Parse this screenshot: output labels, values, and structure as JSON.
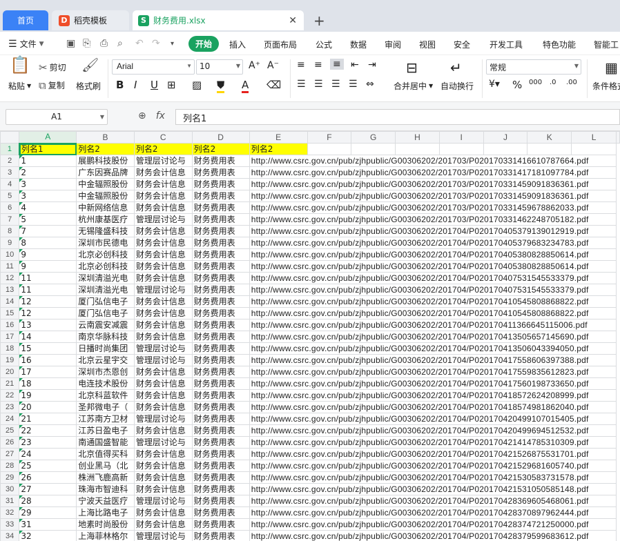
{
  "tabs": {
    "home": "首页",
    "template": "稻壳模板",
    "document": "财务费用.xlsx"
  },
  "menu": {
    "file": "文件",
    "items": [
      "开始",
      "插入",
      "页面布局",
      "公式",
      "数据",
      "审阅",
      "视图",
      "安全",
      "开发工具",
      "特色功能",
      "智能工"
    ]
  },
  "ribbon": {
    "paste": "粘贴",
    "cut": "剪切",
    "copy": "复制",
    "format_painter": "格式刷",
    "font_name": "Arial",
    "font_size": "10",
    "merge_center": "合并居中",
    "wrap_text": "自动换行",
    "number_format": "常规",
    "conditional_format": "条件格式"
  },
  "formula_bar": {
    "cell_ref": "A1",
    "fx": "fx",
    "content": "列名1"
  },
  "sheet": {
    "columns": [
      "A",
      "B",
      "C",
      "D",
      "E",
      "F",
      "G",
      "H",
      "I",
      "J",
      "K",
      "L"
    ],
    "header_row": [
      "列名1",
      "列名2",
      "列名2",
      "列名2",
      "列名2"
    ],
    "rows": [
      [
        "2",
        "1",
        "展鹏科技股份",
        "管理层讨论与",
        "财务费用表",
        "http://www.csrc.gov.cn/pub/zjhpublic/G00306202/201703/P020170331416610787664.pdf"
      ],
      [
        "3",
        "2",
        "广东因赛品牌",
        "财务会计信息",
        "财务费用表",
        "http://www.csrc.gov.cn/pub/zjhpublic/G00306202/201703/P020170331417181097784.pdf"
      ],
      [
        "4",
        "3",
        "中金辐照股份",
        "财务会计信息",
        "财务费用表",
        "http://www.csrc.gov.cn/pub/zjhpublic/G00306202/201703/P020170331459091836361.pdf"
      ],
      [
        "5",
        "3",
        "中金辐照股份",
        "财务会计信息",
        "财务费用表",
        "http://www.csrc.gov.cn/pub/zjhpublic/G00306202/201703/P020170331459091836361.pdf"
      ],
      [
        "6",
        "4",
        "中新网络信息",
        "财务会计信息",
        "财务费用表",
        "http://www.csrc.gov.cn/pub/zjhpublic/G00306202/201703/P020170331459678862033.pdf"
      ],
      [
        "7",
        "5",
        "杭州康基医疗",
        "管理层讨论与",
        "财务费用表",
        "http://www.csrc.gov.cn/pub/zjhpublic/G00306202/201703/P020170331462248705182.pdf"
      ],
      [
        "8",
        "7",
        "无锡隆盛科技",
        "财务会计信息",
        "财务费用表",
        "http://www.csrc.gov.cn/pub/zjhpublic/G00306202/201704/P020170405379139012919.pdf"
      ],
      [
        "9",
        "8",
        "深圳市民德电",
        "财务会计信息",
        "财务费用表",
        "http://www.csrc.gov.cn/pub/zjhpublic/G00306202/201704/P020170405379683234783.pdf"
      ],
      [
        "10",
        "9",
        "北京必创科技",
        "财务会计信息",
        "财务费用表",
        "http://www.csrc.gov.cn/pub/zjhpublic/G00306202/201704/P020170405380828850614.pdf"
      ],
      [
        "11",
        "9",
        "北京必创科技",
        "财务会计信息",
        "财务费用表",
        "http://www.csrc.gov.cn/pub/zjhpublic/G00306202/201704/P020170405380828850614.pdf"
      ],
      [
        "12",
        "11",
        "深圳清溢光电",
        "财务会计信息",
        "财务费用表",
        "http://www.csrc.gov.cn/pub/zjhpublic/G00306202/201704/P020170407531545533379.pdf"
      ],
      [
        "13",
        "11",
        "深圳清溢光电",
        "管理层讨论与",
        "财务费用表",
        "http://www.csrc.gov.cn/pub/zjhpublic/G00306202/201704/P020170407531545533379.pdf"
      ],
      [
        "14",
        "12",
        "厦门弘信电子",
        "财务会计信息",
        "财务费用表",
        "http://www.csrc.gov.cn/pub/zjhpublic/G00306202/201704/P020170410545808868822.pdf"
      ],
      [
        "15",
        "12",
        "厦门弘信电子",
        "财务会计信息",
        "财务费用表",
        "http://www.csrc.gov.cn/pub/zjhpublic/G00306202/201704/P020170410545808868822.pdf"
      ],
      [
        "16",
        "13",
        "云南震安减震",
        "财务会计信息",
        "财务费用表",
        "http://www.csrc.gov.cn/pub/zjhpublic/G00306202/201704/P020170411366645115006.pdf"
      ],
      [
        "17",
        "14",
        "南京华脉科技",
        "财务会计信息",
        "财务费用表",
        "http://www.csrc.gov.cn/pub/zjhpublic/G00306202/201704/P020170413505657145690.pdf"
      ],
      [
        "18",
        "15",
        "日播时尚集团",
        "管理层讨论与",
        "财务费用表",
        "http://www.csrc.gov.cn/pub/zjhpublic/G00306202/201704/P020170413506043394050.pdf"
      ],
      [
        "19",
        "16",
        "北京云星宇交",
        "管理层讨论与",
        "财务费用表",
        "http://www.csrc.gov.cn/pub/zjhpublic/G00306202/201704/P020170417558606397388.pdf"
      ],
      [
        "20",
        "17",
        "深圳市杰恩创",
        "财务会计信息",
        "财务费用表",
        "http://www.csrc.gov.cn/pub/zjhpublic/G00306202/201704/P020170417559835612823.pdf"
      ],
      [
        "21",
        "18",
        "电连技术股份",
        "财务会计信息",
        "财务费用表",
        "http://www.csrc.gov.cn/pub/zjhpublic/G00306202/201704/P020170417560198733650.pdf"
      ],
      [
        "22",
        "19",
        "北京科蓝软件",
        "财务会计信息",
        "财务费用表",
        "http://www.csrc.gov.cn/pub/zjhpublic/G00306202/201704/P020170418572624208999.pdf"
      ],
      [
        "23",
        "20",
        "圣邦微电子（",
        "财务会计信息",
        "财务费用表",
        "http://www.csrc.gov.cn/pub/zjhpublic/G00306202/201704/P020170418574981862040.pdf"
      ],
      [
        "24",
        "21",
        "江苏南方卫材",
        "管理层讨论与",
        "财务费用表",
        "http://www.csrc.gov.cn/pub/zjhpublic/G00306202/201704/P020170420499107015405.pdf"
      ],
      [
        "25",
        "22",
        "江苏日盈电子",
        "财务会计信息",
        "财务费用表",
        "http://www.csrc.gov.cn/pub/zjhpublic/G00306202/201704/P020170420499694512532.pdf"
      ],
      [
        "26",
        "23",
        "南通国盛智能",
        "管理层讨论与",
        "财务费用表",
        "http://www.csrc.gov.cn/pub/zjhpublic/G00306202/201704/P020170421414785310309.pdf"
      ],
      [
        "27",
        "24",
        "北京值得买科",
        "财务会计信息",
        "财务费用表",
        "http://www.csrc.gov.cn/pub/zjhpublic/G00306202/201704/P020170421526875531701.pdf"
      ],
      [
        "28",
        "25",
        "创业黑马（北",
        "财务会计信息",
        "财务费用表",
        "http://www.csrc.gov.cn/pub/zjhpublic/G00306202/201704/P020170421529681605740.pdf"
      ],
      [
        "29",
        "26",
        "株洲飞鹿高新",
        "财务会计信息",
        "财务费用表",
        "http://www.csrc.gov.cn/pub/zjhpublic/G00306202/201704/P020170421530583731578.pdf"
      ],
      [
        "30",
        "27",
        "珠海市智迪科",
        "财务会计信息",
        "财务费用表",
        "http://www.csrc.gov.cn/pub/zjhpublic/G00306202/201704/P020170421531050585148.pdf"
      ],
      [
        "31",
        "28",
        "宁波天益医疗",
        "管理层讨论与",
        "财务费用表",
        "http://www.csrc.gov.cn/pub/zjhpublic/G00306202/201704/P020170428369605468061.pdf"
      ],
      [
        "32",
        "29",
        "上海比路电子",
        "财务会计信息",
        "财务费用表",
        "http://www.csrc.gov.cn/pub/zjhpublic/G00306202/201704/P020170428370897962444.pdf"
      ],
      [
        "33",
        "31",
        "地素时尚股份",
        "财务会计信息",
        "财务费用表",
        "http://www.csrc.gov.cn/pub/zjhpublic/G00306202/201704/P020170428374721250000.pdf"
      ],
      [
        "34",
        "32",
        "上海菲林格尔",
        "管理层讨论与",
        "财务费用表",
        "http://www.csrc.gov.cn/pub/zjhpublic/G00306202/201704/P020170428379599683612.pdf"
      ]
    ]
  }
}
